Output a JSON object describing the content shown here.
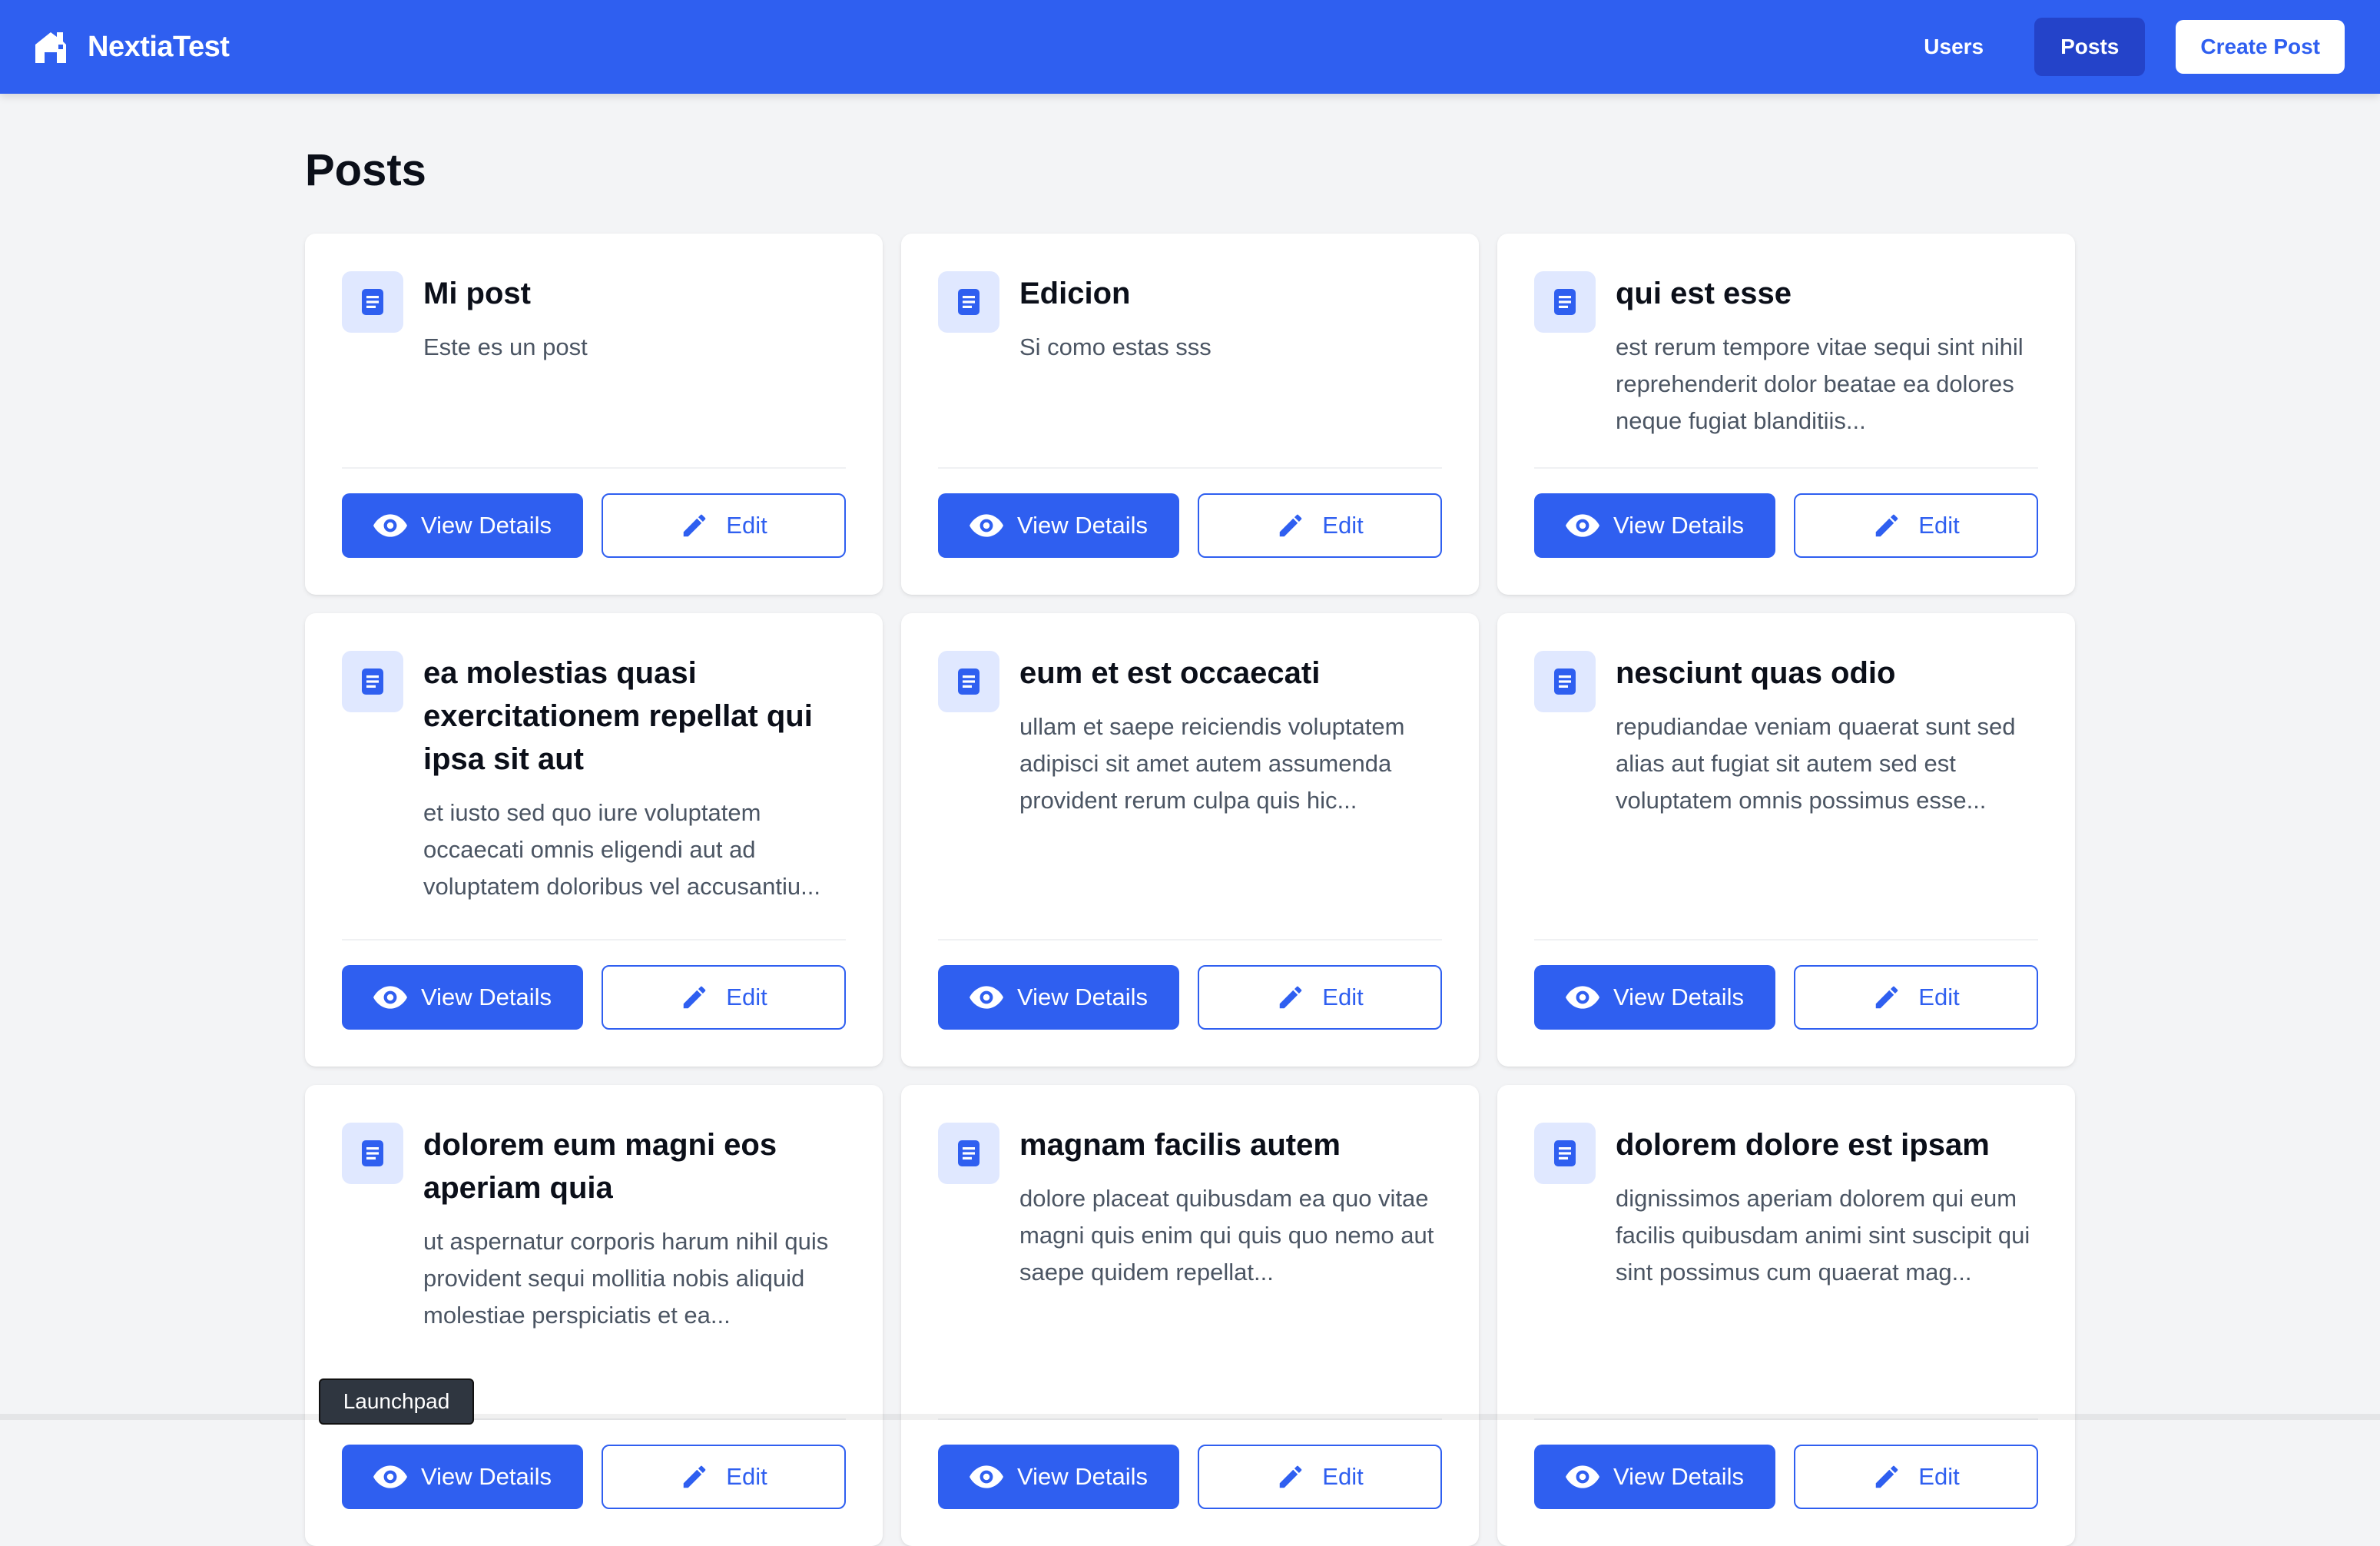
{
  "header": {
    "brand": "NextiaTest",
    "nav": [
      {
        "label": "Users",
        "active": false
      },
      {
        "label": "Posts",
        "active": true
      }
    ],
    "create_label": "Create Post"
  },
  "page": {
    "title": "Posts"
  },
  "posts": [
    {
      "title": "Mi post",
      "body": "Este es un post"
    },
    {
      "title": "Edicion",
      "body": "Si como estas sss"
    },
    {
      "title": "qui est esse",
      "body": "est rerum tempore vitae sequi sint nihil reprehenderit dolor beatae ea dolores neque fugiat blanditiis..."
    },
    {
      "title": "ea molestias quasi exercitationem repellat qui ipsa sit aut",
      "body": "et iusto sed quo iure voluptatem occaecati omnis eligendi aut ad voluptatem doloribus vel accusantiu..."
    },
    {
      "title": "eum et est occaecati",
      "body": "ullam et saepe reiciendis voluptatem adipisci sit amet autem assumenda provident rerum culpa quis hic..."
    },
    {
      "title": "nesciunt quas odio",
      "body": "repudiandae veniam quaerat sunt sed alias aut fugiat sit autem sed est voluptatem omnis possimus esse..."
    },
    {
      "title": "dolorem eum magni eos aperiam quia",
      "body": "ut aspernatur corporis harum nihil quis provident sequi mollitia nobis aliquid molestiae perspiciatis et ea..."
    },
    {
      "title": "magnam facilis autem",
      "body": "dolore placeat quibusdam ea quo vitae magni quis enim qui quis quo nemo aut saepe quidem repellat..."
    },
    {
      "title": "dolorem dolore est ipsam",
      "body": "dignissimos aperiam dolorem qui eum facilis quibusdam animi sint suscipit qui sint possimus cum quaerat mag..."
    }
  ],
  "buttons": {
    "view": "View Details",
    "edit": "Edit"
  },
  "dock": {
    "tooltip": "Launchpad"
  },
  "colors": {
    "primary": "#2f5ff0",
    "active_nav": "#2443c9",
    "background": "#f3f4f6",
    "icon_bg": "#e0e8ff"
  }
}
